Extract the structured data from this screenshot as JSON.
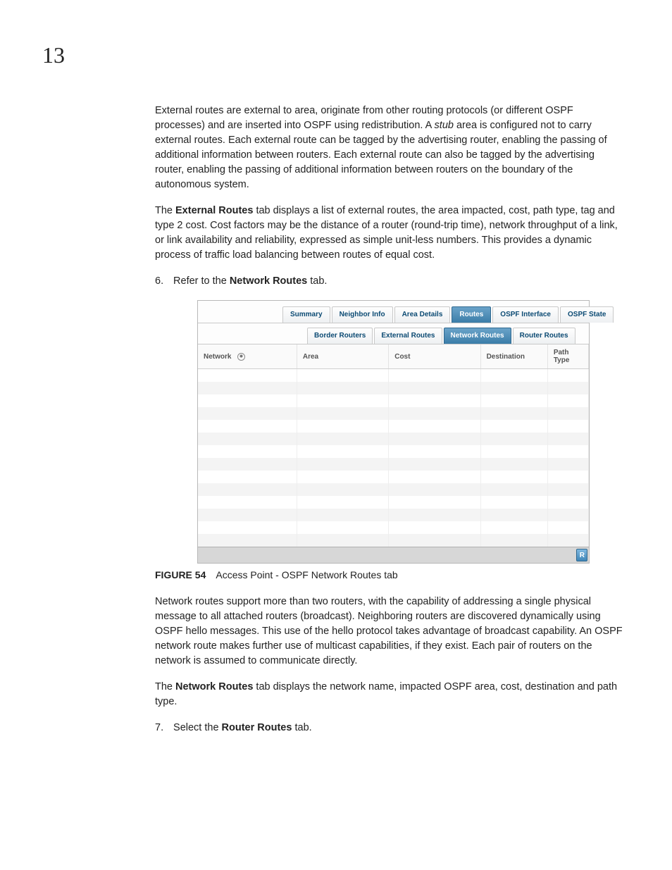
{
  "chapter": "13",
  "paragraphs": {
    "p1_a": "External routes are external to area, originate from other routing protocols (or different OSPF processes) and are inserted into OSPF using redistribution. A ",
    "p1_stub": "stub",
    "p1_b": " area is configured not to carry external routes. Each external route can be tagged by the advertising router, enabling the passing of additional information between routers. Each external route can also be tagged by the advertising router, enabling the passing of additional information between routers on the boundary of the autonomous system.",
    "p2_a": "The ",
    "p2_bold": "External Routes",
    "p2_b": " tab displays a list of external routes, the area impacted, cost, path type, tag and type 2 cost. Cost factors may be the distance of a router (round-trip time), network throughput of a link, or link availability and reliability, expressed as simple unit-less numbers. This provides a dynamic process of traffic load balancing between routes of equal cost.",
    "p3": "Network routes support more than two routers, with the capability of addressing a single physical message to all attached routers (broadcast). Neighboring routers are discovered dynamically using OSPF hello messages. This use of the hello protocol takes advantage of broadcast capability. An OSPF network route makes further use of multicast capabilities, if they exist. Each pair of routers on the network is assumed to communicate directly.",
    "p4_a": "The ",
    "p4_bold": "Network Routes",
    "p4_b": " tab displays the network name, impacted OSPF area, cost, destination and path type."
  },
  "steps": {
    "s6_num": "6.",
    "s6_a": "Refer to the ",
    "s6_bold": "Network Routes",
    "s6_b": " tab.",
    "s7_num": "7.",
    "s7_a": "Select the ",
    "s7_bold": "Router Routes",
    "s7_b": " tab."
  },
  "figure": {
    "label": "FIGURE 54",
    "caption": "Access Point - OSPF Network Routes tab",
    "tabs": {
      "summary": "Summary",
      "neighbor": "Neighbor Info",
      "area": "Area Details",
      "routes": "Routes",
      "ospf_if": "OSPF Interface",
      "ospf_state": "OSPF State"
    },
    "subtabs": {
      "border": "Border Routers",
      "external": "External Routes",
      "network": "Network Routes",
      "router": "Router Routes"
    },
    "columns": {
      "network": "Network",
      "area": "Area",
      "cost": "Cost",
      "destination": "Destination",
      "path_type": "Path Type"
    },
    "footer_btn": "R"
  }
}
